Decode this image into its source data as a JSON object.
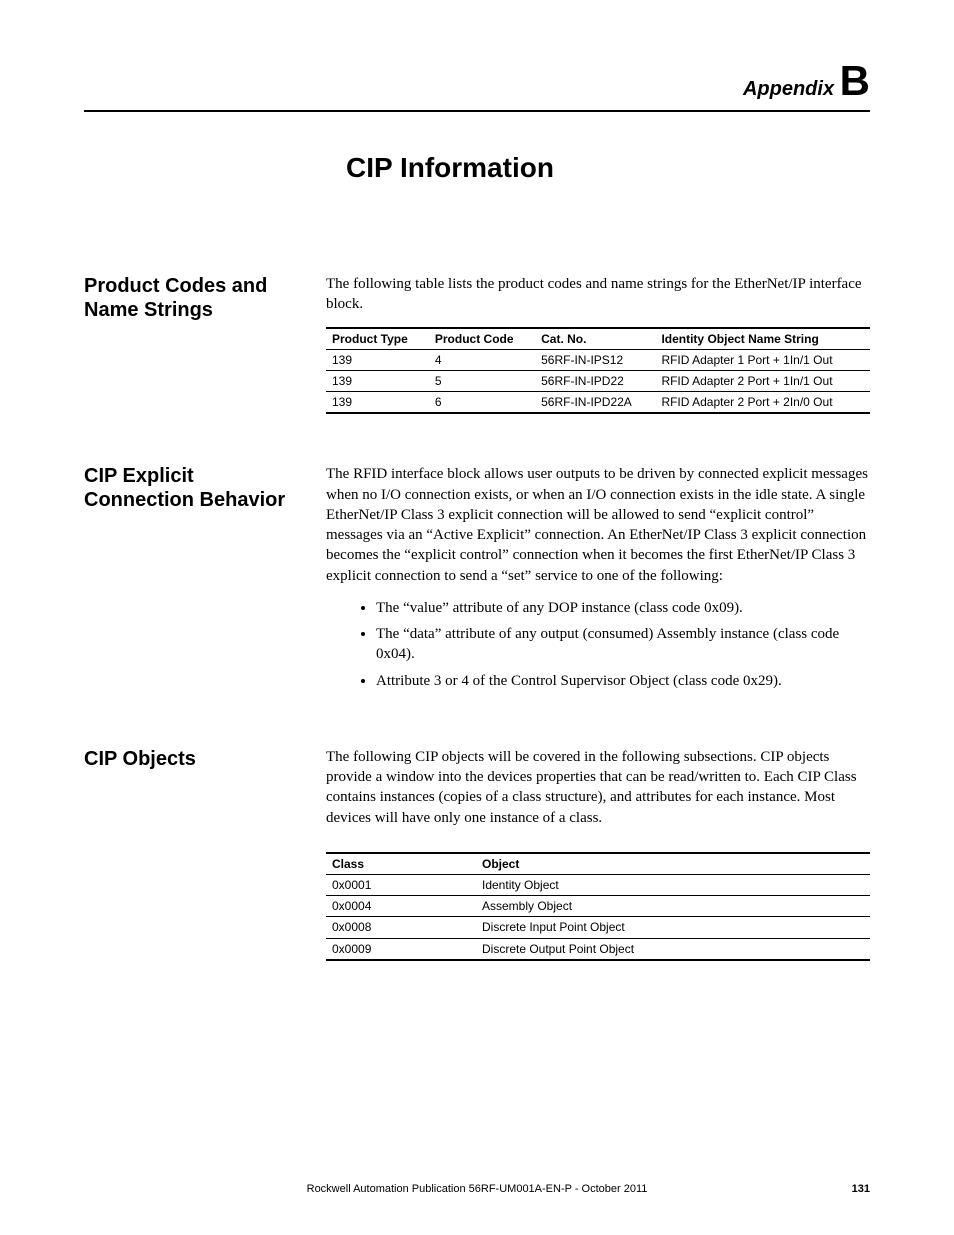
{
  "appendix": {
    "prefix": "Appendix",
    "letter": "B"
  },
  "title": "CIP Information",
  "sections": {
    "s1": {
      "heading": "Product Codes and Name Strings",
      "intro": "The following table lists the product codes and name strings for the EtherNet/IP interface block.",
      "table": {
        "headers": [
          "Product Type",
          "Product Code",
          "Cat. No.",
          "Identity Object Name String"
        ],
        "rows": [
          [
            "139",
            "4",
            "56RF-IN-IPS12",
            "RFID Adapter 1 Port + 1In/1 Out"
          ],
          [
            "139",
            "5",
            "56RF-IN-IPD22",
            "RFID Adapter 2 Port + 1In/1 Out"
          ],
          [
            "139",
            "6",
            "56RF-IN-IPD22A",
            "RFID Adapter 2 Port + 2In/0 Out"
          ]
        ]
      }
    },
    "s2": {
      "heading": "CIP Explicit Connection Behavior",
      "para": "The RFID interface block allows user outputs to be driven by connected explicit messages when no I/O connection exists, or when an I/O connection exists in the idle state. A single EtherNet/IP Class 3 explicit connection will be allowed to send “explicit control” messages via an “Active Explicit” connection. An EtherNet/IP Class 3 explicit connection becomes the “explicit control” connection when it becomes the first EtherNet/IP Class 3 explicit connection to send a “set” service to one of the following:",
      "bullets": [
        "The “value” attribute of any DOP instance (class code 0x09).",
        "The “data” attribute of any output (consumed) Assembly instance (class code 0x04).",
        "Attribute 3 or 4 of the Control Supervisor Object (class code 0x29)."
      ]
    },
    "s3": {
      "heading": "CIP Objects",
      "para": "The following CIP objects will be covered in the following subsections. CIP objects provide a window into the devices properties that can be read/written to. Each CIP Class contains instances (copies of a class structure), and attributes for each instance. Most devices will have only one instance of a class.",
      "table": {
        "headers": [
          "Class",
          "Object"
        ],
        "rows": [
          [
            "0x0001",
            "Identity Object"
          ],
          [
            "0x0004",
            "Assembly Object"
          ],
          [
            "0x0008",
            "Discrete Input Point Object"
          ],
          [
            "0x0009",
            "Discrete Output Point Object"
          ]
        ]
      }
    }
  },
  "footer": {
    "pub": "Rockwell Automation Publication 56RF-UM001A-EN-P - October 2011",
    "page": "131"
  }
}
